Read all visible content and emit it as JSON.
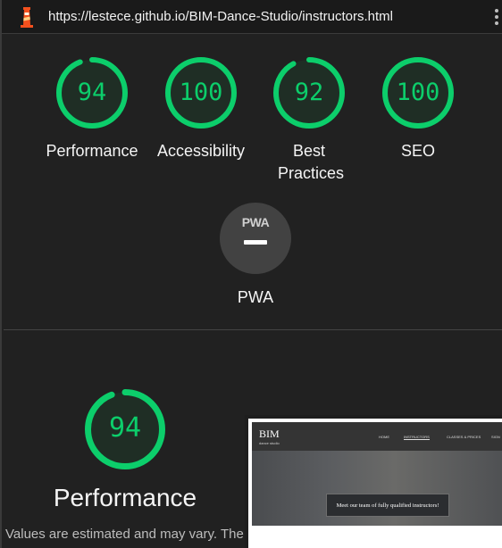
{
  "urlbar": {
    "url": "https://lestece.github.io/BIM-Dance-Studio/instructors.html",
    "logo_icon": "lighthouse-icon",
    "menu_icon": "kebab-menu-icon"
  },
  "colors": {
    "pass_green": "#0cce6b",
    "background": "#212121",
    "pwa_gray": "#424242"
  },
  "categories": [
    {
      "label": "Performance",
      "score": "94",
      "value": 94
    },
    {
      "label": "Accessibility",
      "score": "100",
      "value": 100
    },
    {
      "label": "Best Practices",
      "score": "92",
      "value": 92
    },
    {
      "label": "SEO",
      "score": "100",
      "value": 100
    }
  ],
  "pwa": {
    "badge_text": "PWA",
    "label": "PWA"
  },
  "performance_section": {
    "score": "94",
    "value": 94,
    "title": "Performance",
    "note": "Values are estimated and may vary. The"
  },
  "thumbnail": {
    "brand": "BIM",
    "brand_sub": "dance studio",
    "nav": [
      "HOME",
      "INSTRUCTORS",
      "CLASSES & PRICES",
      "SIGN"
    ],
    "caption": "Meet our team of fully qualified instructors!"
  }
}
